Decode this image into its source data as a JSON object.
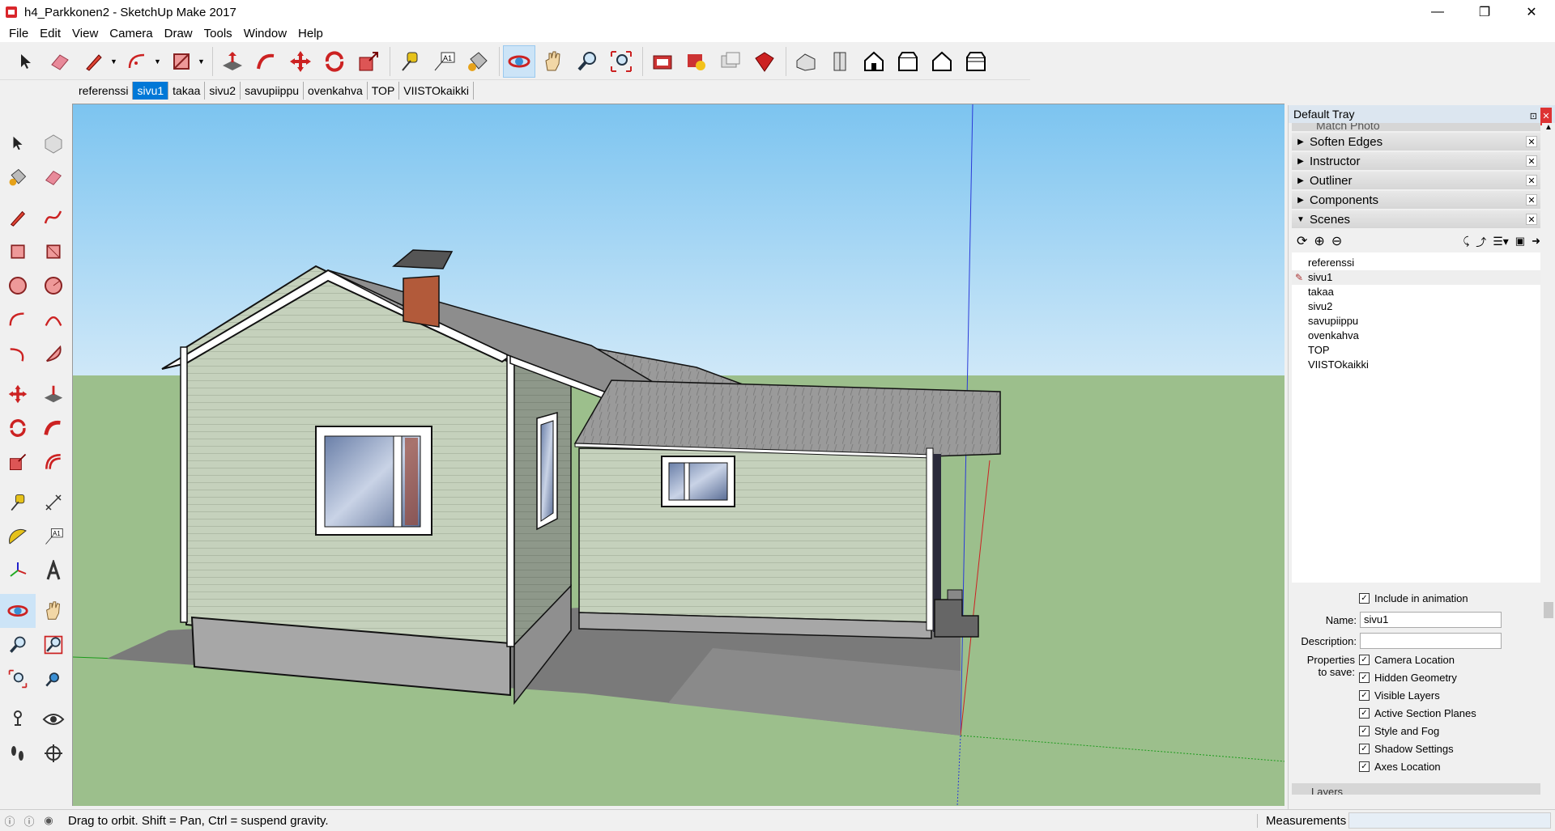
{
  "window": {
    "title": "h4_Parkkonen2 - SketchUp Make 2017",
    "minimize": "—",
    "maximize": "❐",
    "close": "✕"
  },
  "menu": [
    "File",
    "Edit",
    "View",
    "Camera",
    "Draw",
    "Tools",
    "Window",
    "Help"
  ],
  "scene_tabs": {
    "items": [
      "referenssi",
      "sivu1",
      "takaa",
      "sivu2",
      "savupiippu",
      "ovenkahva",
      "TOP",
      "VIISTOkaikki"
    ],
    "active": "sivu1"
  },
  "tray": {
    "title": "Default Tray",
    "pin_icon": "pin-icon",
    "close_icon": "close-icon",
    "panels": [
      {
        "label": "Soften Edges",
        "expanded": false
      },
      {
        "label": "Instructor",
        "expanded": false
      },
      {
        "label": "Outliner",
        "expanded": false
      },
      {
        "label": "Components",
        "expanded": false
      },
      {
        "label": "Scenes",
        "expanded": true
      }
    ],
    "hidden_panel_partial": "Match Photo",
    "bottom_panel_partial": "Layers"
  },
  "scenes": {
    "list": [
      "referenssi",
      "sivu1",
      "takaa",
      "sivu2",
      "savupiippu",
      "ovenkahva",
      "TOP",
      "VIISTOkaikki"
    ],
    "current": "sivu1",
    "include_in_animation": "Include in animation",
    "name_label": "Name:",
    "name_value": "sivu1",
    "description_label": "Description:",
    "description_value": "",
    "properties_label_1": "Properties",
    "properties_label_2": "to save:",
    "properties": [
      "Camera Location",
      "Hidden Geometry",
      "Visible Layers",
      "Active Section Planes",
      "Style and Fog",
      "Shadow Settings",
      "Axes Location"
    ]
  },
  "status": {
    "text": "Drag to orbit. Shift = Pan, Ctrl = suspend gravity.",
    "measurements_label": "Measurements",
    "measurements_value": ""
  },
  "colors": {
    "sky_top": "#7cc4f0",
    "sky_bottom": "#cfe8f8",
    "ground": "#9cbf8c",
    "siding": "#c5d1bc",
    "roof": "#7a7a7a",
    "accent": "#0078d7"
  }
}
